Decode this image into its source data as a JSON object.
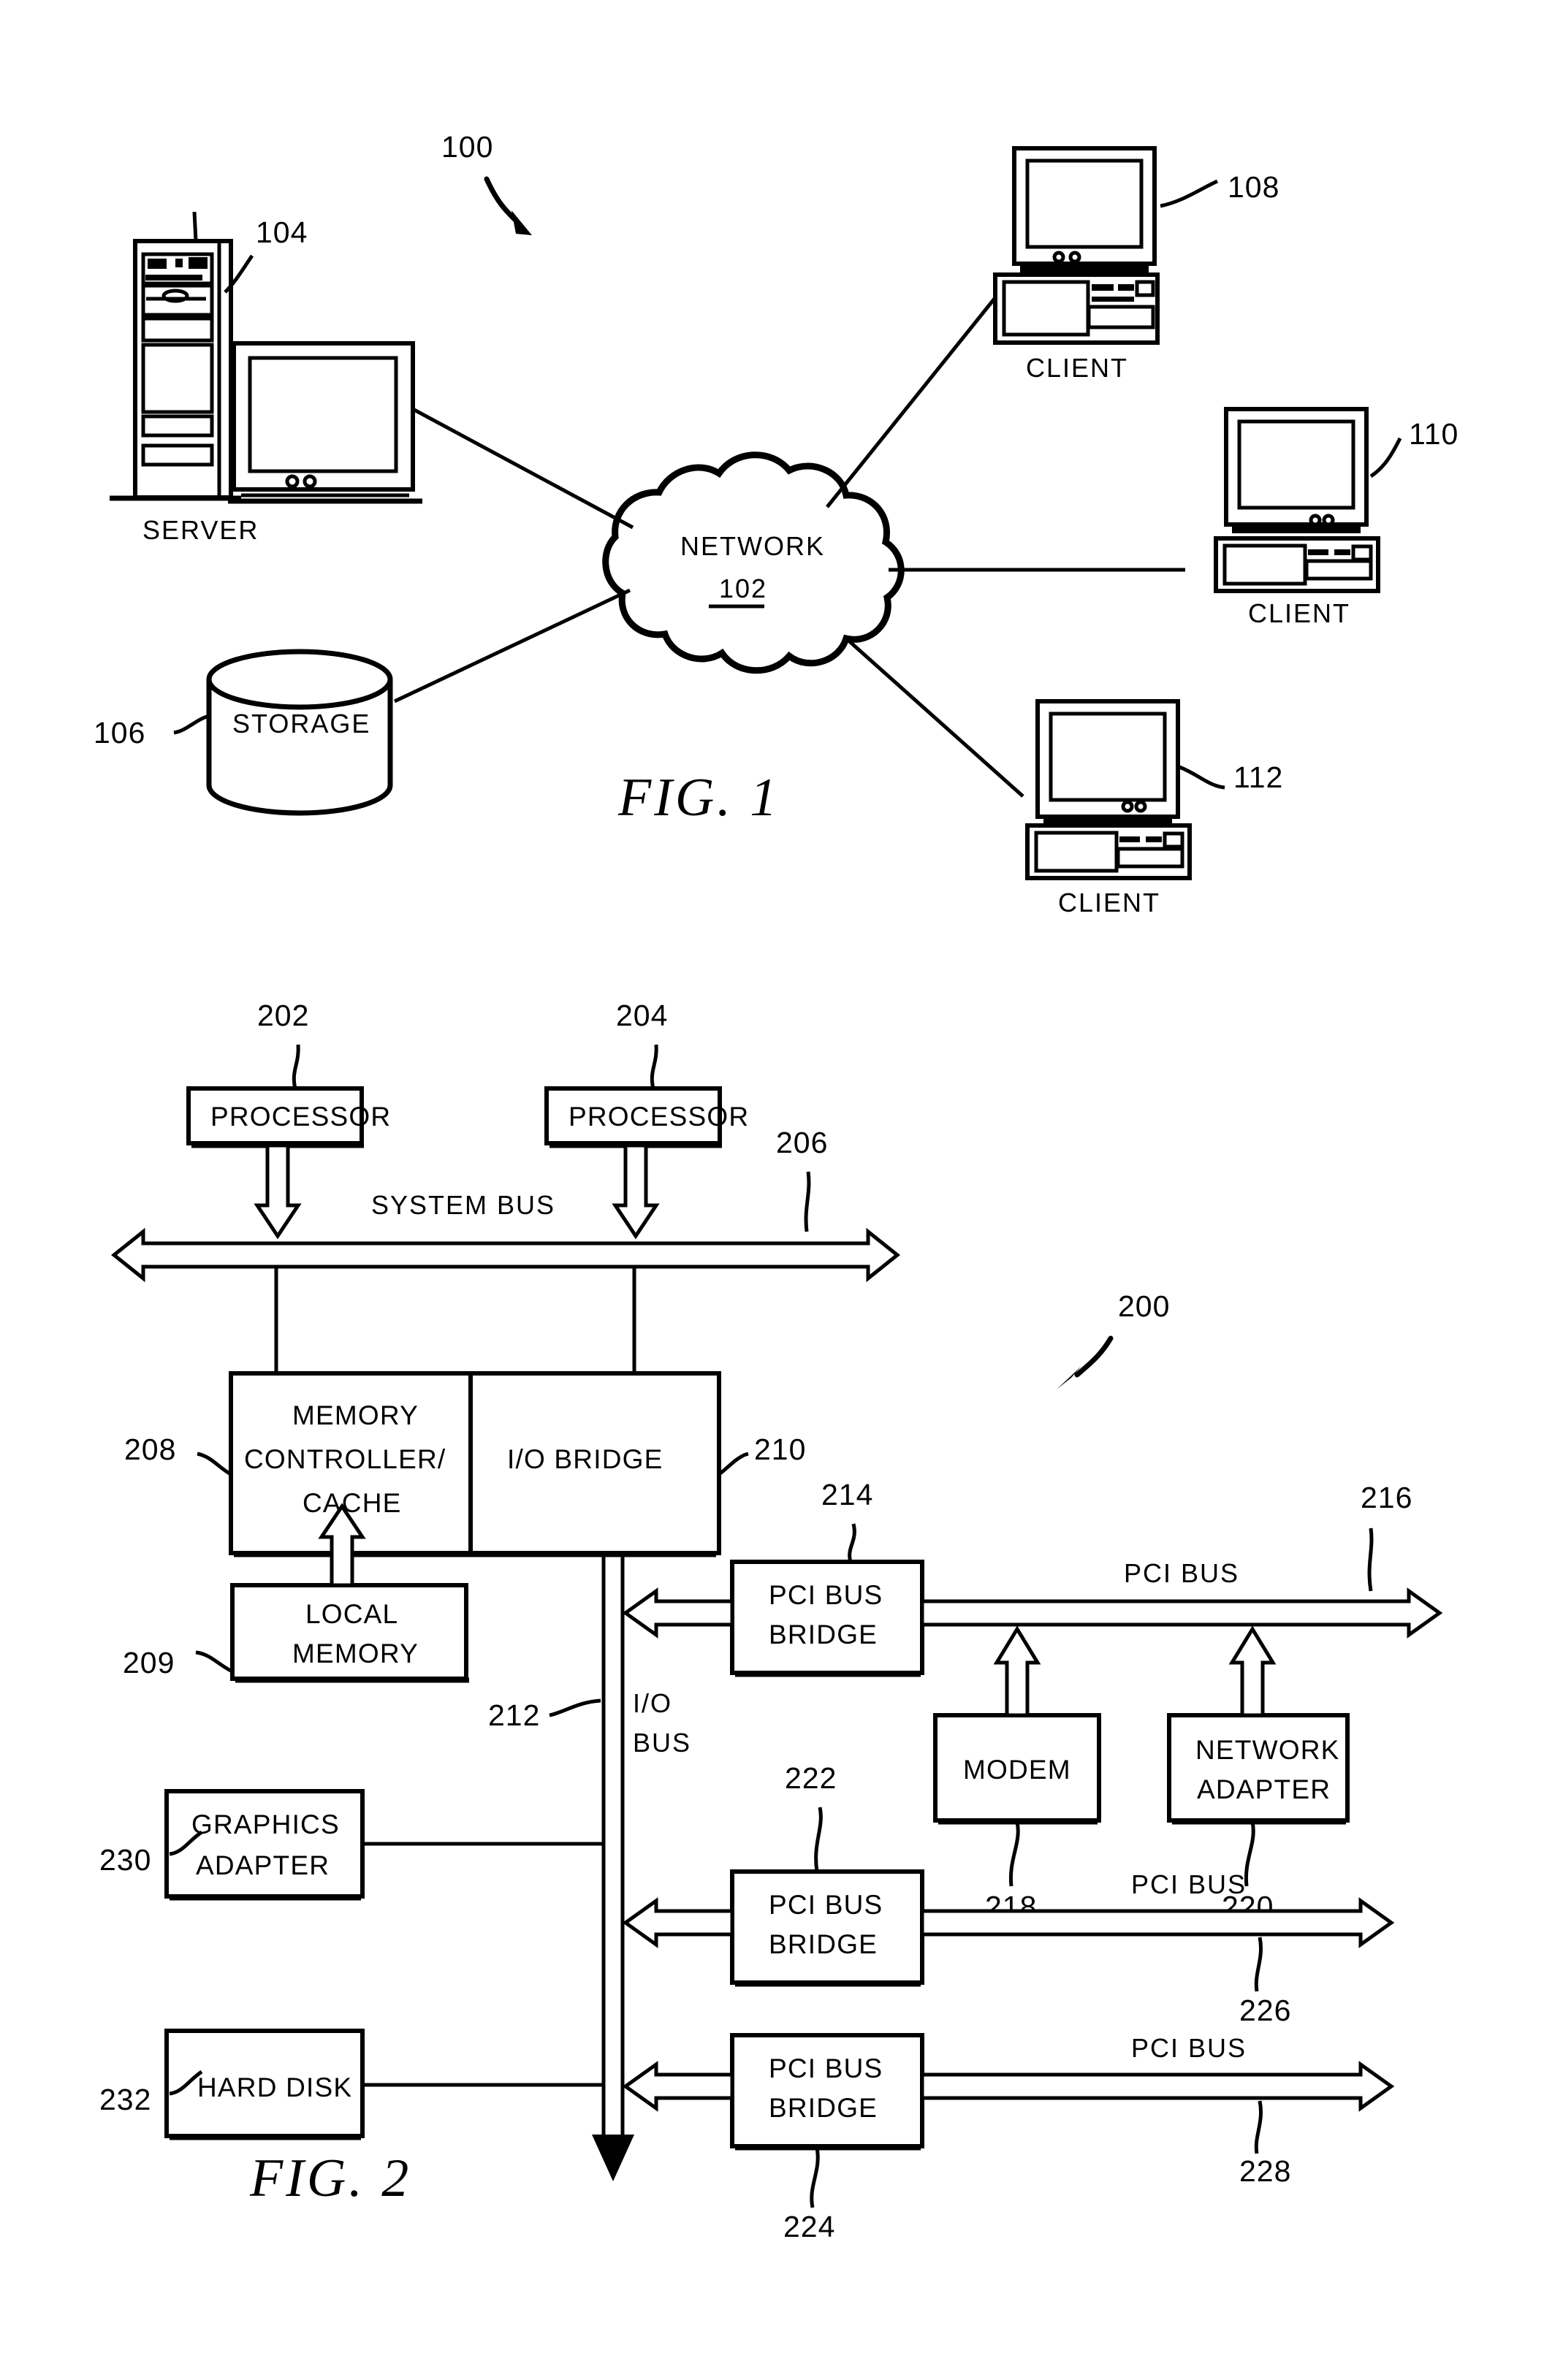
{
  "document": {
    "type": "patent-figure-sheet",
    "figures": [
      "FIG. 1",
      "FIG. 2"
    ]
  },
  "figure1": {
    "caption": "FIG.  1",
    "system_ref": "100",
    "cloud": {
      "label": "NETWORK",
      "ref": "102"
    },
    "server": {
      "label": "SERVER",
      "ref": "104"
    },
    "storage": {
      "label": "STORAGE",
      "ref": "106"
    },
    "clients": [
      {
        "label": "CLIENT",
        "ref": "108"
      },
      {
        "label": "CLIENT",
        "ref": "110"
      },
      {
        "label": "CLIENT",
        "ref": "112"
      }
    ]
  },
  "figure2": {
    "caption": "FIG.  2",
    "system_ref": "200",
    "blocks": [
      {
        "id": "processor1",
        "label": "PROCESSOR",
        "ref": "202"
      },
      {
        "id": "processor2",
        "label": "PROCESSOR",
        "ref": "204"
      },
      {
        "id": "memctl",
        "label_line1": "MEMORY",
        "label_line2": "CONTROLLER/",
        "label_line3": "CACHE",
        "ref": "208"
      },
      {
        "id": "iobridge",
        "label": "I/O  BRIDGE",
        "ref": "210"
      },
      {
        "id": "localmemory",
        "label_line1": "LOCAL",
        "label_line2": "MEMORY",
        "ref": "209"
      },
      {
        "id": "pcibridge1",
        "label_line1": "PCI BUS",
        "label_line2": "BRIDGE",
        "ref": "214"
      },
      {
        "id": "modem",
        "label": "MODEM",
        "ref": "218"
      },
      {
        "id": "networkadapter",
        "label_line1": "NETWORK",
        "label_line2": "ADAPTER",
        "ref": "220"
      },
      {
        "id": "graphicsadapter",
        "label_line1": "GRAPHICS",
        "label_line2": "ADAPTER",
        "ref": "230"
      },
      {
        "id": "pcibridge2",
        "label_line1": "PCI BUS",
        "label_line2": "BRIDGE",
        "ref": "222"
      },
      {
        "id": "harddisk",
        "label": "HARD  DISK",
        "ref": "232"
      },
      {
        "id": "pcibridge3",
        "label_line1": "PCI BUS",
        "label_line2": "BRIDGE",
        "ref": "224"
      }
    ],
    "buses": [
      {
        "id": "systembus",
        "label": "SYSTEM  BUS",
        "ref": "206"
      },
      {
        "id": "iobus",
        "label_line1": "I/O",
        "label_line2": "BUS",
        "ref": "212"
      },
      {
        "id": "pcibus1",
        "label": "PCI  BUS",
        "ref": "216"
      },
      {
        "id": "pcibus2",
        "label": "PCI  BUS",
        "ref": "226"
      },
      {
        "id": "pcibus3",
        "label": "PCI  BUS",
        "ref": "228"
      }
    ]
  },
  "colors": {
    "ink": "#000000",
    "paper": "#ffffff"
  }
}
